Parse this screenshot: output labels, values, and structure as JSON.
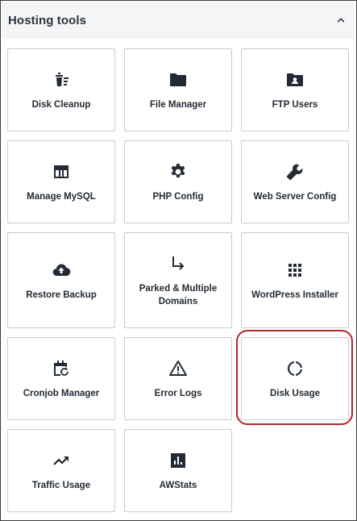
{
  "section": {
    "title": "Hosting tools",
    "toggle_icon": "chevron-up-icon"
  },
  "tools": [
    {
      "label": "Disk Cleanup",
      "icon": "trash-list-icon"
    },
    {
      "label": "File Manager",
      "icon": "folder-icon"
    },
    {
      "label": "FTP Users",
      "icon": "folder-user-icon"
    },
    {
      "label": "Manage MySQL",
      "icon": "table-icon"
    },
    {
      "label": "PHP Config",
      "icon": "gear-icon"
    },
    {
      "label": "Web Server Config",
      "icon": "wrench-icon"
    },
    {
      "label": "Restore Backup",
      "icon": "cloud-upload-icon"
    },
    {
      "label": "Parked & Multiple Domains",
      "icon": "arrow-down-right-icon"
    },
    {
      "label": "WordPress Installer",
      "icon": "grid-dots-icon"
    },
    {
      "label": "Cronjob Manager",
      "icon": "calendar-refresh-icon"
    },
    {
      "label": "Error Logs",
      "icon": "warning-icon"
    },
    {
      "label": "Disk Usage",
      "icon": "donut-progress-icon"
    },
    {
      "label": "Traffic Usage",
      "icon": "trending-up-icon"
    },
    {
      "label": "AWStats",
      "icon": "bar-chart-icon"
    }
  ],
  "highlighted_tool": "Disk Usage",
  "colors": {
    "highlight": "#b5262b",
    "header_bg": "#f4f5f7",
    "text": "#222b35",
    "tile_border": "#c9ccd1"
  }
}
